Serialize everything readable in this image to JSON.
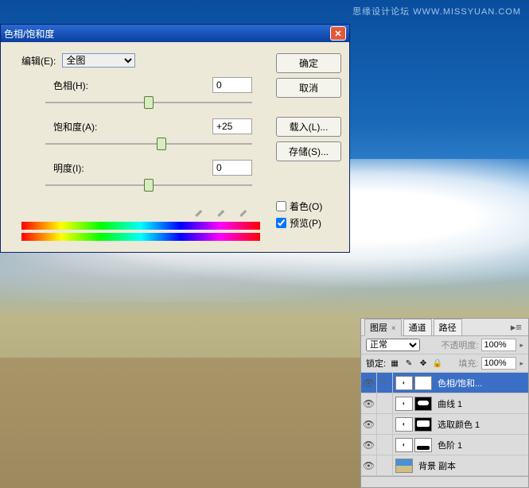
{
  "watermark": "思缘设计论坛  WWW.MISSYUAN.COM",
  "dialog": {
    "title": "色相/饱和度",
    "edit_label": "编辑(E):",
    "edit_value": "全图",
    "hue_label": "色相(H):",
    "hue_value": "0",
    "sat_label": "饱和度(A):",
    "sat_value": "+25",
    "light_label": "明度(I):",
    "light_value": "0",
    "colorize_label": "着色(O)",
    "preview_label": "预览(P)",
    "btn_ok": "确定",
    "btn_cancel": "取消",
    "btn_load": "载入(L)...",
    "btn_save": "存储(S)..."
  },
  "panel": {
    "tab_layers": "图层",
    "tab_channels": "通道",
    "tab_paths": "路径",
    "blend_mode": "正常",
    "opacity_label": "不透明度:",
    "opacity_value": "100%",
    "lock_label": "锁定:",
    "fill_label": "填充:",
    "fill_value": "100%",
    "layers": [
      {
        "name": "色相/饱和...",
        "selected": true
      },
      {
        "name": "曲线 1"
      },
      {
        "name": "选取颜色 1"
      },
      {
        "name": "色阶 1"
      },
      {
        "name": "背景 副本"
      }
    ]
  }
}
